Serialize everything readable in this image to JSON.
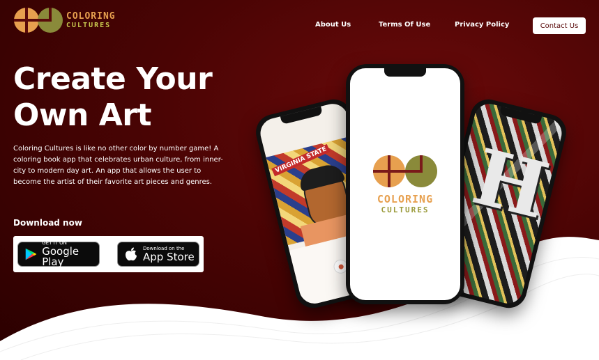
{
  "colors": {
    "background": "#4a0404",
    "logo_orange": "#e7a04f",
    "logo_olive": "#8a8a3a",
    "contact_text": "#5a0a0a"
  },
  "brand": {
    "name_top": "COLORING",
    "name_bottom": "CULTURES"
  },
  "nav": {
    "about": "About Us",
    "terms": "Terms Of Use",
    "privacy": "Privacy Policy",
    "contact": "Contact Us"
  },
  "hero": {
    "title_line1": "Create Your",
    "title_line2": "Own Art",
    "description": "Coloring Cultures is like no other color by number game! A coloring book app that celebrates urban culture, from inner-city to modern day art. An app that allows the user to become the artist of their favorite art pieces and genres.",
    "download_label": "Download now"
  },
  "stores": {
    "google_small": "GET IT ON",
    "google_big": "Google Play",
    "apple_small": "Download on the",
    "apple_big": "App Store"
  },
  "phones": {
    "left_banner": "VIRGINIA STATE",
    "right_letter": "H"
  }
}
